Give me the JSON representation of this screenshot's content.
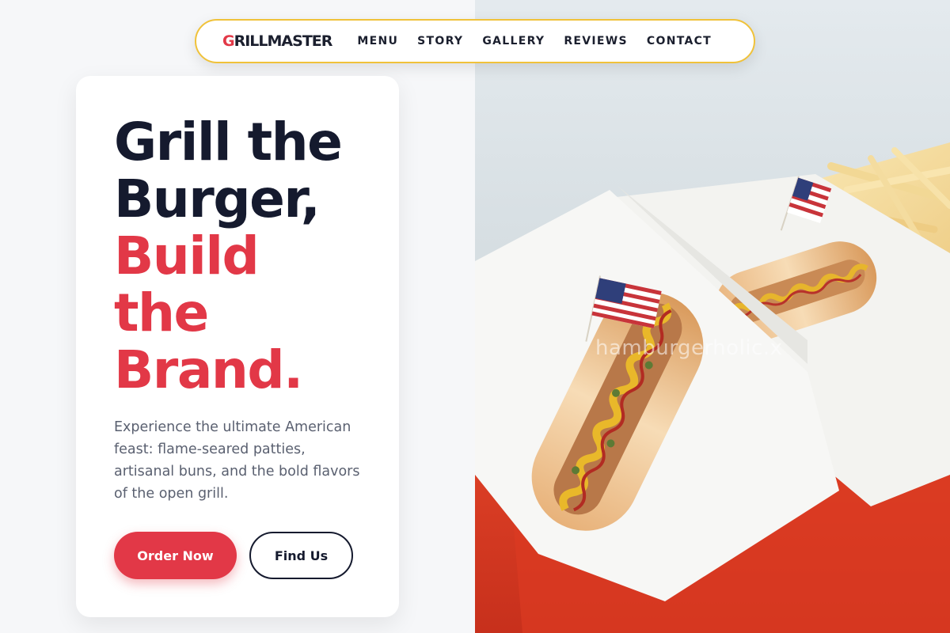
{
  "brand": {
    "first_letter": "G",
    "rest": "RILLMASTER",
    "accent_color": "#e23847"
  },
  "nav": {
    "items": [
      {
        "label": "MENU"
      },
      {
        "label": "STORY"
      },
      {
        "label": "GALLERY"
      },
      {
        "label": "REVIEWS"
      },
      {
        "label": "CONTACT"
      }
    ],
    "border_color": "#f0c23a"
  },
  "hero": {
    "headline_dark": [
      "Grill the",
      "Burger,"
    ],
    "headline_red": [
      "Build",
      "the",
      "Brand."
    ],
    "lead": "Experience the ultimate American feast: flame-seared patties, artisanal buns, and the bold flavors of the open grill.",
    "primary_button": "Order Now",
    "secondary_button": "Find Us"
  },
  "image": {
    "watermark": "hamburgerholic.x",
    "subject": "hot-dogs-with-flags-on-red-tray"
  }
}
